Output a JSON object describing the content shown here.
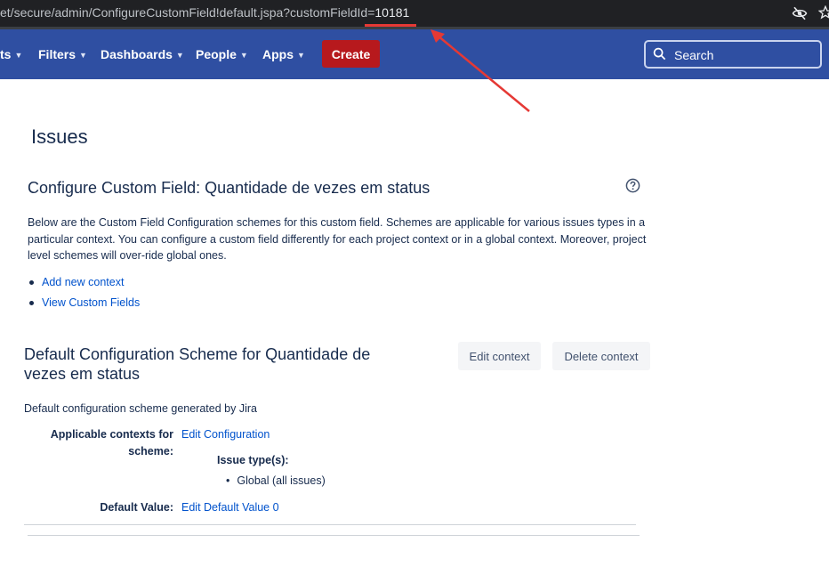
{
  "browser": {
    "url_prefix": "et/secure/admin/ConfigureCustomField!default.jspa?customFieldId=",
    "url_highlight": "10181"
  },
  "nav": {
    "items": [
      {
        "label": "ts"
      },
      {
        "label": "Filters"
      },
      {
        "label": "Dashboards"
      },
      {
        "label": "People"
      },
      {
        "label": "Apps"
      }
    ],
    "create_label": "Create",
    "search_placeholder": "Search"
  },
  "page": {
    "title": "Issues",
    "section_title": "Configure Custom Field: Quantidade de vezes em status",
    "description": "Below are the Custom Field Configuration schemes for this custom field. Schemes are applicable for various issues types in a particular context. You can configure a custom field differently for each project context or in a global context. Moreover, project level schemes will over-ride global ones.",
    "links": [
      {
        "label": "Add new context"
      },
      {
        "label": "View Custom Fields"
      }
    ]
  },
  "scheme": {
    "title": "Default Configuration Scheme for Quantidade de vezes em status",
    "edit_context_label": "Edit context",
    "delete_context_label": "Delete context",
    "description": "Default configuration scheme generated by Jira",
    "contexts_label": "Applicable contexts for scheme:",
    "contexts_link": "Edit Configuration",
    "issue_types_label": "Issue type(s):",
    "issue_types": [
      "Global (all issues)"
    ],
    "default_value_label": "Default Value:",
    "default_value_link": "Edit Default Value 0"
  },
  "colors": {
    "nav_background": "#2f4fa2",
    "create_button": "#b7191d",
    "link": "#0052cc",
    "annotation": "#e53935"
  }
}
